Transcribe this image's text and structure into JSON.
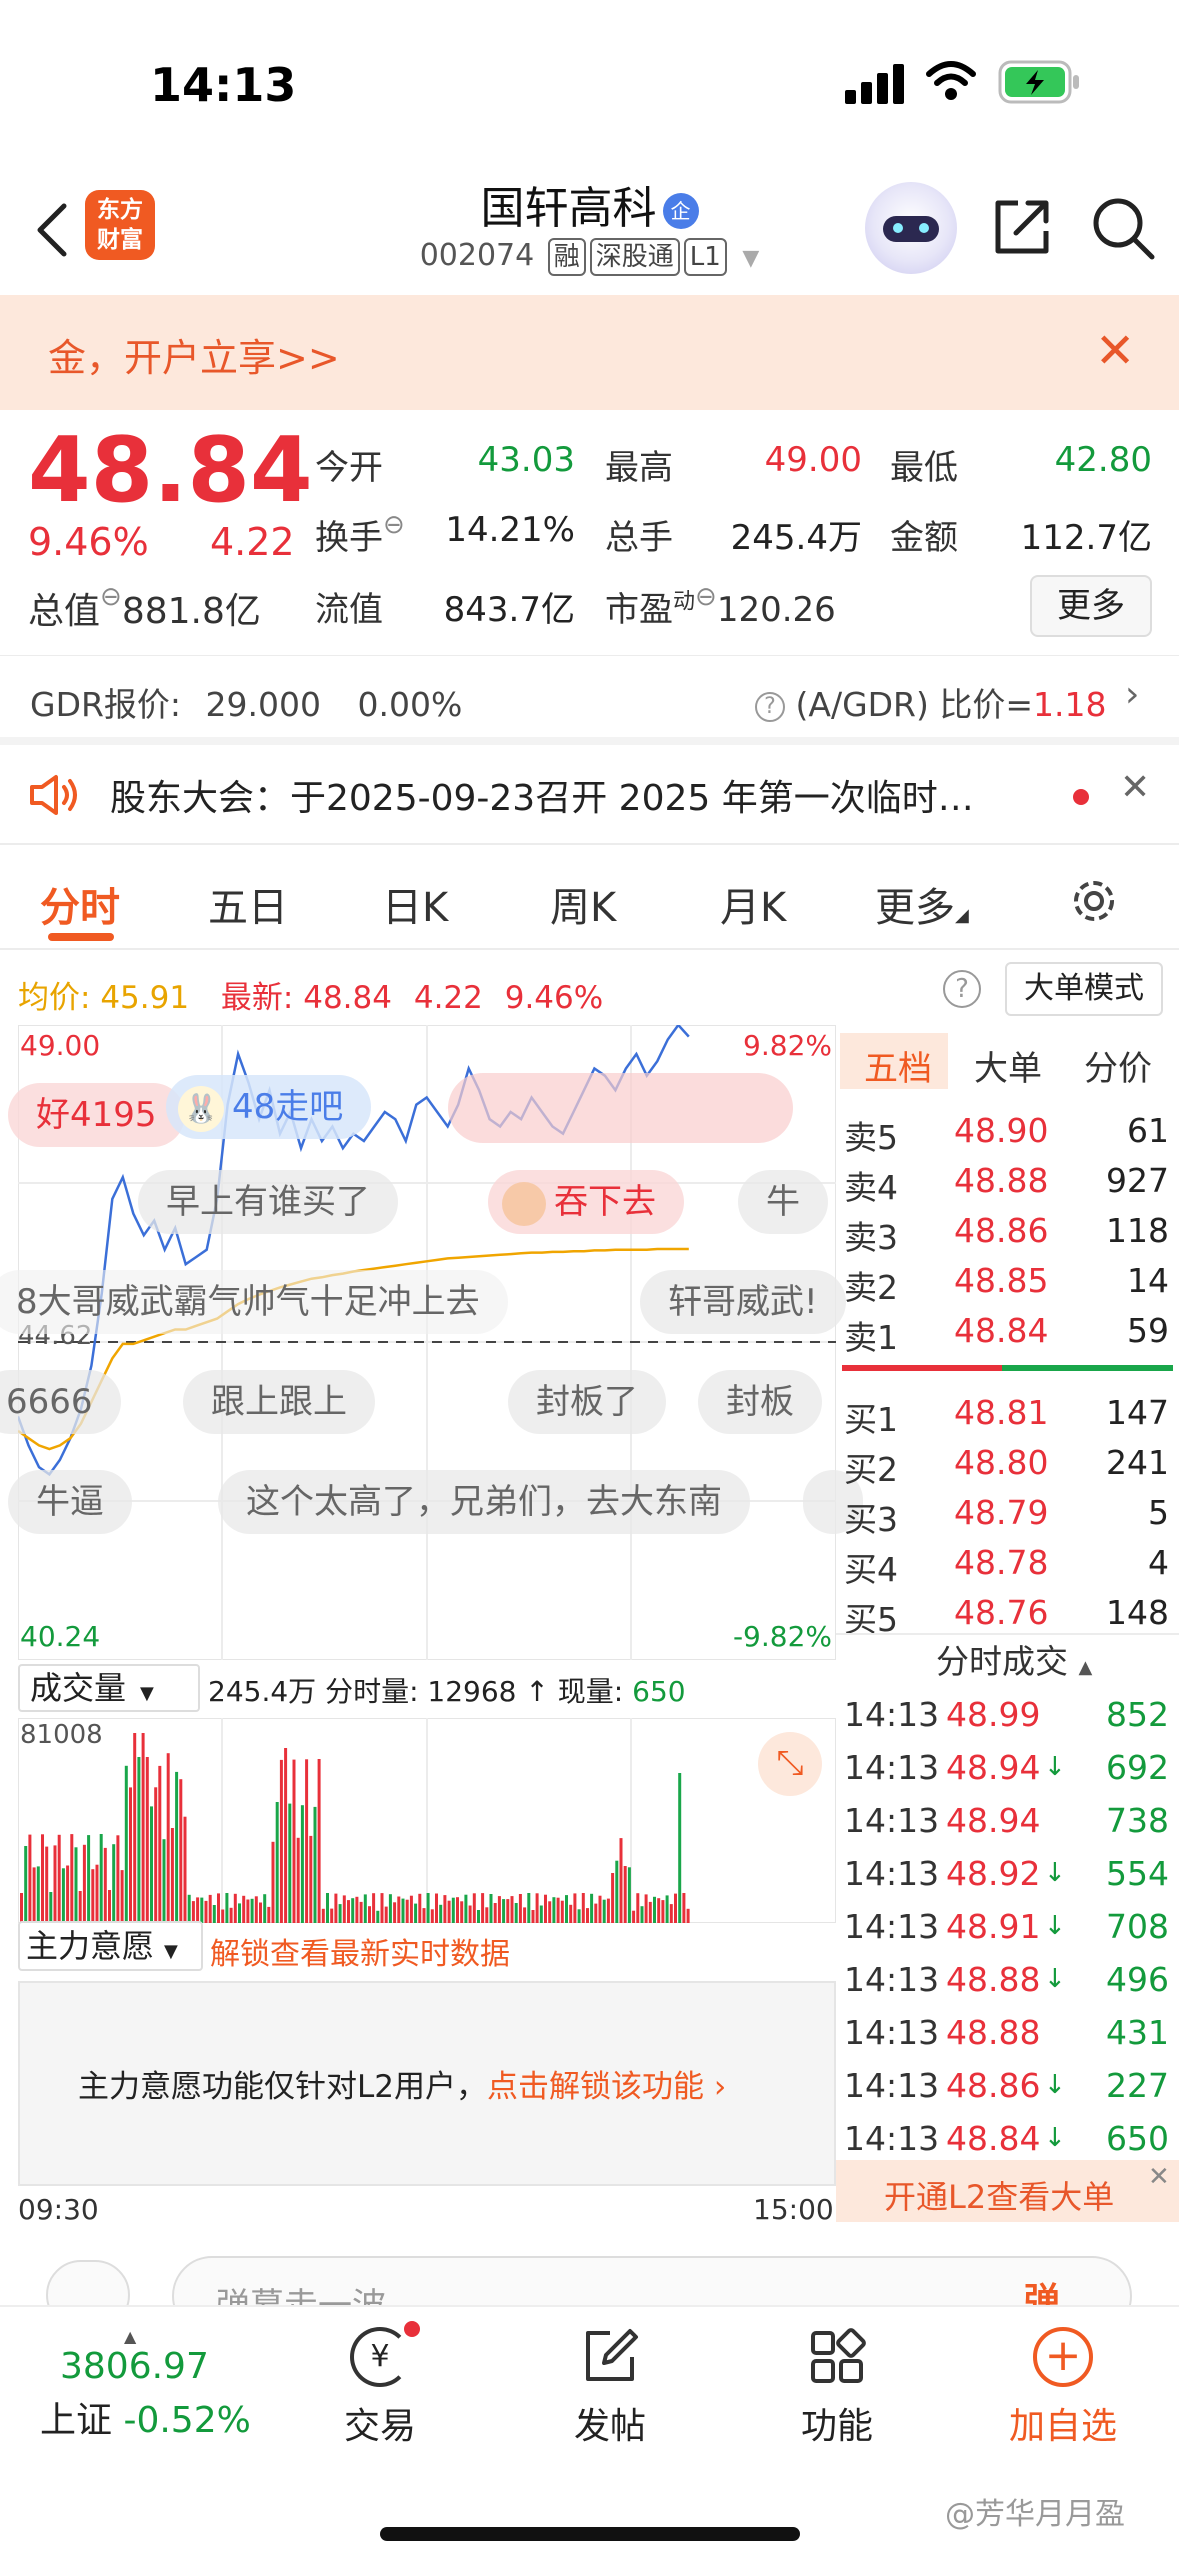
{
  "status_bar": {
    "time": "14:13"
  },
  "header": {
    "logo_line1": "东方",
    "logo_line2": "财富",
    "stock_name": "国轩高科",
    "ent_badge": "企",
    "stock_code": "002074",
    "tag_margin": "融",
    "tag_connect": "深股通",
    "tag_level": "L1"
  },
  "promo": {
    "text": "金，开户立享>>"
  },
  "quote": {
    "price": "48.84",
    "change_pct": "9.46%",
    "change": "4.22",
    "open_label": "今开",
    "open": "43.03",
    "high_label": "最高",
    "high": "49.00",
    "low_label": "最低",
    "low": "42.80",
    "turnover_label": "换手",
    "turnover": "14.21%",
    "volume_label": "总手",
    "volume": "245.4万",
    "amount_label": "金额",
    "amount": "112.7亿",
    "total_value_label": "总值",
    "total_value": "881.8亿",
    "float_value_label": "流值",
    "float_value": "843.7亿",
    "pe_label": "市盈",
    "pe_sup": "动",
    "pe": "120.26",
    "more": "更多"
  },
  "gdr": {
    "label": "GDR报价:",
    "price": "29.000",
    "pct": "0.00%",
    "ratio_label": "(A/GDR) 比价=",
    "ratio": "1.18"
  },
  "notice": {
    "text": "股东大会：于2025-09-23召开 2025 年第一次临时…"
  },
  "tabs": [
    "分时",
    "五日",
    "日K",
    "周K",
    "月K",
    "更多"
  ],
  "chart_info": {
    "avg_label": "均价:",
    "avg": "45.91",
    "latest_label": "最新:",
    "latest": "48.84",
    "latest_chg": "4.22",
    "latest_pct": "9.46%",
    "big_order": "大单模式"
  },
  "chart_data": {
    "type": "line",
    "x_start": "09:30",
    "x_end": "15:00",
    "ylim": [
      40.24,
      49.0
    ],
    "y_top_label": "49.00",
    "y_bottom_label": "40.24",
    "y_mid_label": "44.62",
    "pct_top_label": "9.82%",
    "pct_bottom_label": "-9.82%",
    "series": [
      {
        "values": [
          43.6,
          43.2,
          42.9,
          42.8,
          43.0,
          43.3,
          43.7,
          44.3,
          45.3,
          46.6,
          46.9,
          46.4,
          46.1,
          46.3,
          45.9,
          46.2,
          45.7,
          45.8,
          45.9,
          46.6,
          47.9,
          48.6,
          48.2,
          47.7,
          48.1,
          47.5,
          47.8,
          47.3,
          47.7,
          47.4,
          47.6,
          47.3,
          47.5,
          47.4,
          47.6,
          47.8,
          47.7,
          47.4,
          47.9,
          48.0,
          47.8,
          47.6,
          47.9,
          48.4,
          48.1,
          47.7,
          47.6,
          47.8,
          47.7,
          48.0,
          47.8,
          47.6,
          47.5,
          47.8,
          48.1,
          48.4,
          48.3,
          48.1,
          48.4,
          48.6,
          48.3,
          48.5,
          48.8,
          49.0,
          48.84
        ]
      },
      {
        "values": [
          43.4,
          43.3,
          43.2,
          43.15,
          43.2,
          43.3,
          43.5,
          43.8,
          44.1,
          44.4,
          44.6,
          44.6,
          44.65,
          44.7,
          44.75,
          44.8,
          44.8,
          44.85,
          44.9,
          44.95,
          45.05,
          45.15,
          45.22,
          45.28,
          45.33,
          45.38,
          45.42,
          45.46,
          45.5,
          45.52,
          45.55,
          45.57,
          45.6,
          45.62,
          45.64,
          45.66,
          45.68,
          45.7,
          45.72,
          45.74,
          45.76,
          45.78,
          45.79,
          45.8,
          45.81,
          45.82,
          45.83,
          45.84,
          45.85,
          45.86,
          45.86,
          45.87,
          45.87,
          45.88,
          45.88,
          45.89,
          45.89,
          45.9,
          45.9,
          45.9,
          45.9,
          45.91,
          45.91,
          45.91,
          45.91
        ]
      }
    ],
    "volume_label": "成交量",
    "volume_total": "245.4万",
    "volume_period_label": "分时量:",
    "volume_period": "12968",
    "volume_now_label": "现量:",
    "volume_now": "650",
    "volume_max": "81008"
  },
  "danmu": [
    "好4195",
    "48走吧",
    "早上有谁买了",
    "吞下去",
    "牛",
    "8大哥威武霸气帅气十足冲上去",
    "轩哥威武!",
    "6666",
    "跟上跟上",
    "封板了",
    "封板",
    "牛逼",
    "这个太高了，兄弟们，去大东南"
  ],
  "order_book": {
    "tabs": [
      "五档",
      "大单",
      "分价"
    ],
    "asks": [
      {
        "label": "卖5",
        "price": "48.90",
        "vol": "61"
      },
      {
        "label": "卖4",
        "price": "48.88",
        "vol": "927"
      },
      {
        "label": "卖3",
        "price": "48.86",
        "vol": "118"
      },
      {
        "label": "卖2",
        "price": "48.85",
        "vol": "14"
      },
      {
        "label": "卖1",
        "price": "48.84",
        "vol": "59"
      }
    ],
    "bids": [
      {
        "label": "买1",
        "price": "48.81",
        "vol": "147"
      },
      {
        "label": "买2",
        "price": "48.80",
        "vol": "241"
      },
      {
        "label": "买3",
        "price": "48.79",
        "vol": "5"
      },
      {
        "label": "买4",
        "price": "48.78",
        "vol": "4"
      },
      {
        "label": "买5",
        "price": "48.76",
        "vol": "148"
      }
    ],
    "trades_title": "分时成交",
    "trades": [
      {
        "time": "14:13",
        "price": "48.99",
        "arrow": "",
        "vol": "852"
      },
      {
        "time": "14:13",
        "price": "48.94",
        "arrow": "↓",
        "vol": "692"
      },
      {
        "time": "14:13",
        "price": "48.94",
        "arrow": "",
        "vol": "738"
      },
      {
        "time": "14:13",
        "price": "48.92",
        "arrow": "↓",
        "vol": "554"
      },
      {
        "time": "14:13",
        "price": "48.91",
        "arrow": "↓",
        "vol": "708"
      },
      {
        "time": "14:13",
        "price": "48.88",
        "arrow": "↓",
        "vol": "496"
      },
      {
        "time": "14:13",
        "price": "48.88",
        "arrow": "",
        "vol": "431"
      },
      {
        "time": "14:13",
        "price": "48.86",
        "arrow": "↓",
        "vol": "227"
      },
      {
        "time": "14:13",
        "price": "48.84",
        "arrow": "↓",
        "vol": "650"
      }
    ],
    "l2_banner": "开通L2查看大单"
  },
  "main_force": {
    "label": "主力意愿",
    "unlock_link": "解锁查看最新实时数据",
    "notice": "主力意愿功能仅针对L2用户，",
    "notice_link": "点击解锁该功能"
  },
  "comment": {
    "placeholder": "弹幕走一波",
    "btn": "弹"
  },
  "bottom_nav": {
    "index_value": "3806.97",
    "index_name": "上证",
    "index_pct": "-0.52%",
    "trade": "交易",
    "post": "发帖",
    "func": "功能",
    "add": "加自选"
  },
  "watermark": "@芳华月月盈"
}
